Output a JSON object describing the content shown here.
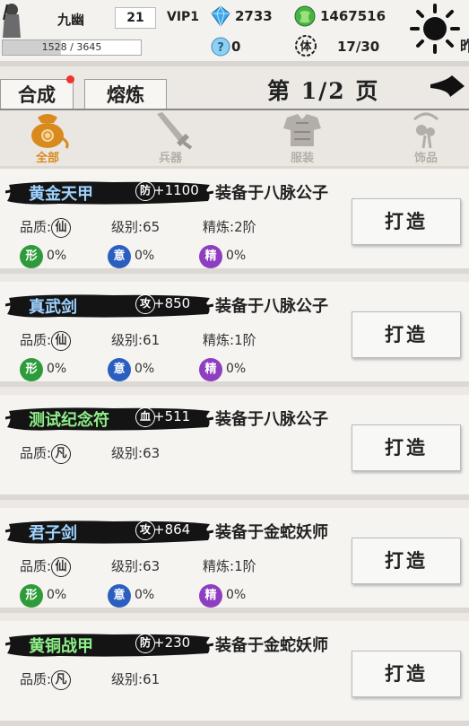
{
  "player": {
    "name": "九幽",
    "level": "21",
    "vip": "VIP1",
    "exp_text": "1528 / 3645",
    "exp_fraction": 0.419,
    "diamonds": "2733",
    "jade": "1467516",
    "tokens": "0",
    "stamina": "17/30",
    "stamina_icon_char": "体",
    "cut_char": "昨"
  },
  "tabs": [
    {
      "label": "合成",
      "active": true,
      "has_dot": true
    },
    {
      "label": "熔炼",
      "active": false,
      "has_dot": false
    }
  ],
  "pagination": {
    "text": "第 1/2 页"
  },
  "categories": [
    {
      "label": "全部",
      "icon": "bag-icon",
      "active": true
    },
    {
      "label": "兵器",
      "icon": "sword-icon",
      "active": false
    },
    {
      "label": "服装",
      "icon": "armor-icon",
      "active": false
    },
    {
      "label": "饰品",
      "icon": "pendant-icon",
      "active": false
    }
  ],
  "labels": {
    "quality": "品质:",
    "level": "级别:",
    "refine": "精炼:",
    "forge": "打造"
  },
  "items": [
    {
      "name": "黄金天甲",
      "name_color": "#9fd3ff",
      "stat_icon": "防",
      "stat_value": "+1100",
      "equipped": "装备于八脉公子",
      "quality_char": "仙",
      "level": "65",
      "refine": "2阶",
      "show_gems": true,
      "gems": [
        {
          "char": "形",
          "value": "0%",
          "color": "#2e9b3a"
        },
        {
          "char": "意",
          "value": "0%",
          "color": "#2a5fc0"
        },
        {
          "char": "精",
          "value": "0%",
          "color": "#8e3ec0"
        }
      ]
    },
    {
      "name": "真武剑",
      "name_color": "#9fd3ff",
      "stat_icon": "攻",
      "stat_value": "+850",
      "equipped": "装备于八脉公子",
      "quality_char": "仙",
      "level": "61",
      "refine": "1阶",
      "show_gems": true,
      "gems": [
        {
          "char": "形",
          "value": "0%",
          "color": "#2e9b3a"
        },
        {
          "char": "意",
          "value": "0%",
          "color": "#2a5fc0"
        },
        {
          "char": "精",
          "value": "0%",
          "color": "#8e3ec0"
        }
      ]
    },
    {
      "name": "测试纪念符",
      "name_color": "#8ef08a",
      "stat_icon": "血",
      "stat_value": "+511",
      "equipped": "装备于八脉公子",
      "quality_char": "凡",
      "level": "63",
      "refine": "",
      "show_gems": false,
      "gems": []
    },
    {
      "name": "君子剑",
      "name_color": "#9fd3ff",
      "stat_icon": "攻",
      "stat_value": "+864",
      "equipped": "装备于金蛇妖师",
      "quality_char": "仙",
      "level": "63",
      "refine": "1阶",
      "show_gems": true,
      "gems": [
        {
          "char": "形",
          "value": "0%",
          "color": "#2e9b3a"
        },
        {
          "char": "意",
          "value": "0%",
          "color": "#2a5fc0"
        },
        {
          "char": "精",
          "value": "0%",
          "color": "#8e3ec0"
        }
      ]
    },
    {
      "name": "黄铜战甲",
      "name_color": "#8ef08a",
      "stat_icon": "防",
      "stat_value": "+230",
      "equipped": "装备于金蛇妖师",
      "quality_char": "凡",
      "level": "61",
      "refine": "",
      "show_gems": false,
      "gems": []
    }
  ],
  "colors": {
    "active_category": "#d98a1e",
    "inactive_category": "#b3afa8",
    "tab_dot": "#e33333"
  }
}
